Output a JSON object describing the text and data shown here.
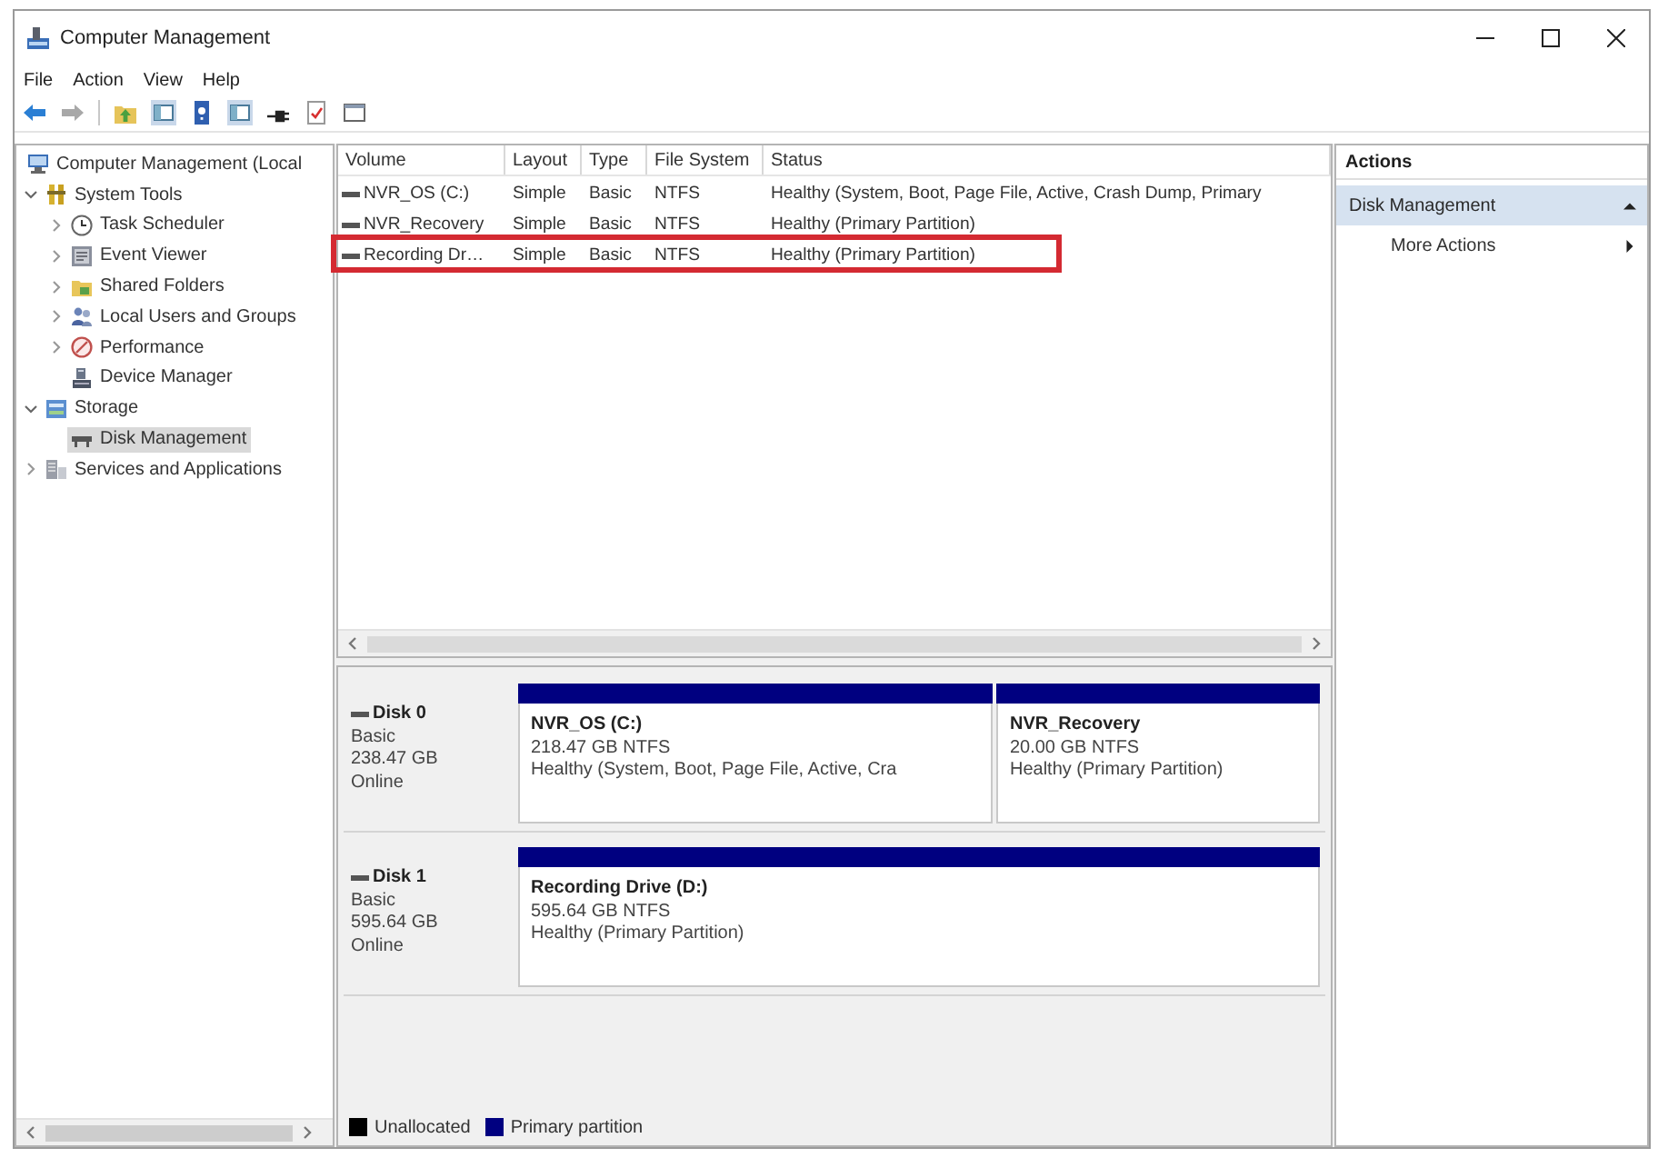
{
  "window": {
    "title": "Computer Management"
  },
  "menu": [
    "File",
    "Action",
    "View",
    "Help"
  ],
  "toolbar": [
    [
      {
        "kind": "back",
        "disabled": false
      },
      {
        "kind": "forward",
        "disabled": true
      }
    ],
    [
      {
        "kind": "folder_up",
        "disabled": false
      },
      {
        "kind": "pane",
        "disabled": false
      },
      {
        "kind": "help",
        "disabled": false
      },
      {
        "kind": "pane",
        "disabled": false
      },
      {
        "kind": "plug",
        "disabled": false
      },
      {
        "kind": "document",
        "disabled": false
      },
      {
        "kind": "window",
        "disabled": false
      }
    ]
  ],
  "tree": [
    {
      "label": "Computer Management (Local",
      "kind": "computer",
      "selected": false,
      "children": [
        {
          "label": "System Tools",
          "kind": "tools",
          "expanded": true,
          "selected": false,
          "children": [
            {
              "label": "Task Scheduler",
              "kind": "clock",
              "expanded": false,
              "selected": false
            },
            {
              "label": "Event Viewer",
              "kind": "log",
              "expanded": false,
              "selected": false
            },
            {
              "label": "Shared Folders",
              "kind": "folder",
              "expanded": false,
              "selected": false
            },
            {
              "label": "Local Users and Groups",
              "kind": "users",
              "expanded": false,
              "selected": false
            },
            {
              "label": "Performance",
              "kind": "gauge",
              "expanded": false,
              "selected": false
            },
            {
              "label": "Device Manager",
              "kind": "device",
              "selected": false
            }
          ]
        },
        {
          "label": "Storage",
          "kind": "storage",
          "expanded": true,
          "selected": false,
          "children": [
            {
              "label": "Disk Management",
              "kind": "disk",
              "selected": true
            }
          ]
        },
        {
          "label": "Services and Applications",
          "kind": "services",
          "expanded": false,
          "selected": false
        }
      ]
    }
  ],
  "volume_list": {
    "columns": [
      "Volume",
      "Layout",
      "Type",
      "File System",
      "Status"
    ],
    "rows": [
      {
        "cells": [
          "NVR_OS (C:)",
          "Simple",
          "Basic",
          "NTFS",
          "Healthy (System, Boot, Page File, Active, Crash Dump, Primary"
        ],
        "highlighted": false
      },
      {
        "cells": [
          "NVR_Recovery",
          "Simple",
          "Basic",
          "NTFS",
          "Healthy (Primary Partition)"
        ],
        "highlighted": false
      },
      {
        "cells": [
          "Recording Dr…",
          "Simple",
          "Basic",
          "NTFS",
          "Healthy (Primary Partition)"
        ],
        "highlighted": true
      }
    ]
  },
  "disks": [
    {
      "name": "Disk 0",
      "type": "Basic",
      "size": "238.47 GB",
      "status": "Online",
      "partitions": [
        {
          "name": "NVR_OS  (C:)",
          "size": "218.47 GB NTFS",
          "status": "Healthy (System, Boot, Page File, Active, Cra",
          "color": "#000080"
        },
        {
          "name": "NVR_Recovery",
          "size": "20.00 GB NTFS",
          "status": "Healthy (Primary Partition)",
          "color": "#000080"
        }
      ]
    },
    {
      "name": "Disk 1",
      "type": "Basic",
      "size": "595.64 GB",
      "status": "Online",
      "partitions": [
        {
          "name": "Recording Drive  (D:)",
          "size": "595.64 GB NTFS",
          "status": "Healthy (Primary Partition)",
          "color": "#000080"
        }
      ]
    }
  ],
  "legend": [
    {
      "label": "Unallocated",
      "color": "#000000"
    },
    {
      "label": "Primary partition",
      "color": "#000080"
    }
  ],
  "actions": {
    "title": "Actions",
    "sections": [
      {
        "label": "Disk Management",
        "expanded": true,
        "items": [
          {
            "label": "More Actions",
            "submenu": true
          }
        ]
      }
    ]
  }
}
